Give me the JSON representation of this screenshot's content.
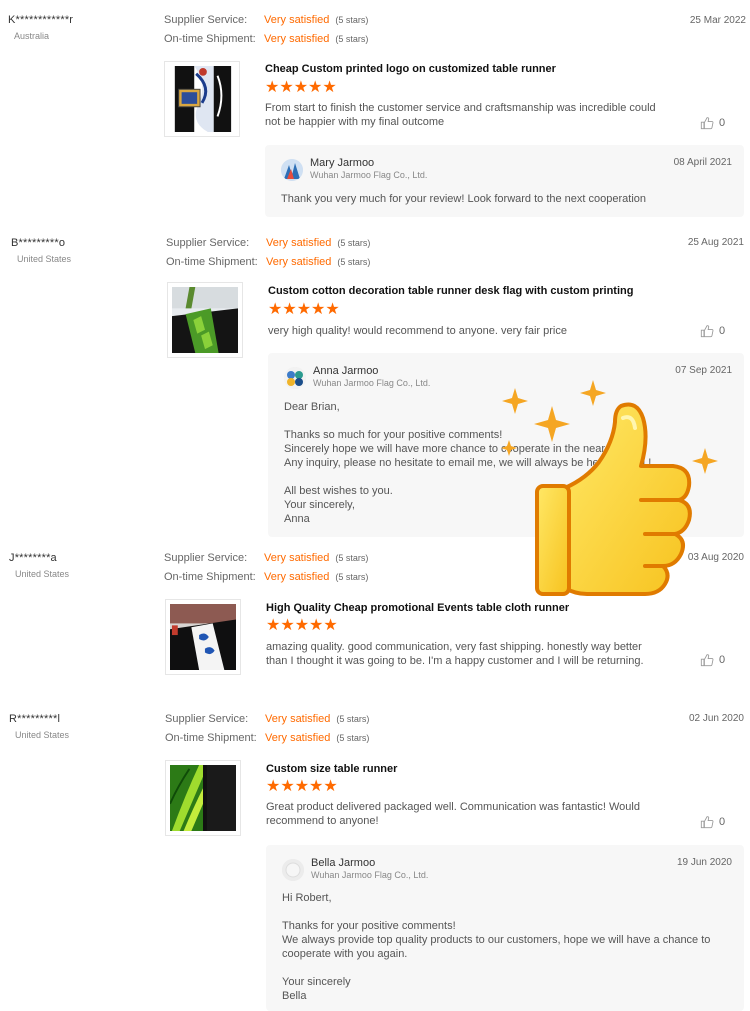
{
  "reviews": [
    {
      "buyer": "K************r",
      "country": "Australia",
      "supplier_service_label": "Supplier Service:",
      "supplier_service_value": "Very satisfied",
      "supplier_service_stars": "(5 stars)",
      "shipment_label": "On-time Shipment:",
      "shipment_value": "Very satisfied",
      "shipment_stars": "(5 stars)",
      "date": "25 Mar 2022",
      "product_title": "Cheap Custom printed logo on customized table runner",
      "rating": "★★★★★",
      "text": "From start to finish the customer service and craftsmanship was incredible could not be happier with my final outcome",
      "likes": "0",
      "reply": {
        "name": "Mary Jarmoo",
        "company": "Wuhan Jarmoo Flag Co., Ltd.",
        "date": "08 April 2021",
        "body": "Thank you very much for your review! Look forward to the next cooperation"
      }
    },
    {
      "buyer": "B*********o",
      "country": "United States",
      "supplier_service_label": "Supplier Service:",
      "supplier_service_value": "Very satisfied",
      "supplier_service_stars": "(5 stars)",
      "shipment_label": "On-time Shipment:",
      "shipment_value": "Very satisfied",
      "shipment_stars": "(5 stars)",
      "date": "25 Aug 2021",
      "product_title": "Custom cotton decoration table runner desk flag with custom printing",
      "rating": "★★★★★",
      "text": "very high quality! would recommend to anyone. very fair price",
      "likes": "0",
      "reply": {
        "name": "Anna Jarmoo",
        "company": "Wuhan Jarmoo Flag Co., Ltd.",
        "date": "07 Sep 2021",
        "body": "Dear Brian,\n\nThanks so much for your positive comments!\nSincerely hope we will have more chance to cooperate in the near future.\nAny inquiry, please no hesitate to email me, we will always be here for you !\n\nAll best wishes to you.\nYour sincerely,\nAnna"
      }
    },
    {
      "buyer": "J********a",
      "country": "United States",
      "supplier_service_label": "Supplier Service:",
      "supplier_service_value": "Very satisfied",
      "supplier_service_stars": "(5 stars)",
      "shipment_label": "On-time Shipment:",
      "shipment_value": "Very satisfied",
      "shipment_stars": "(5 stars)",
      "date": "03 Aug 2020",
      "product_title": "High Quality Cheap promotional Events table cloth runner",
      "rating": "★★★★★",
      "text": "amazing quality. good communication, very fast shipping.  honestly way better than I thought it was going to be. I'm a happy customer and I will be returning.",
      "likes": "0"
    },
    {
      "buyer": "R*********l",
      "country": "United States",
      "supplier_service_label": "Supplier Service:",
      "supplier_service_value": "Very satisfied",
      "supplier_service_stars": "(5 stars)",
      "shipment_label": "On-time Shipment:",
      "shipment_value": "Very satisfied",
      "shipment_stars": "(5 stars)",
      "date": "02 Jun 2020",
      "product_title": "Custom size table runner",
      "rating": "★★★★★",
      "text": "Great product delivered packaged well.  Communication was fantastic!  Would recommend to anyone!",
      "likes": "0",
      "reply": {
        "name": "Bella Jarmoo",
        "company": "Wuhan Jarmoo Flag Co., Ltd.",
        "date": "19 Jun 2020",
        "body": "Hi Robert,\n\nThanks for your positive comments!\nWe always provide top quality products to our customers, hope we will have a chance to cooperate with you again.\n\nYour sincerely\nBella"
      }
    }
  ],
  "colors": {
    "accent": "#ff6a00",
    "reply_bg": "#f7f7f7"
  },
  "icons": {
    "like": "thumbs-up-icon",
    "sticker": "thumbs-up-sparkle-sticker"
  }
}
